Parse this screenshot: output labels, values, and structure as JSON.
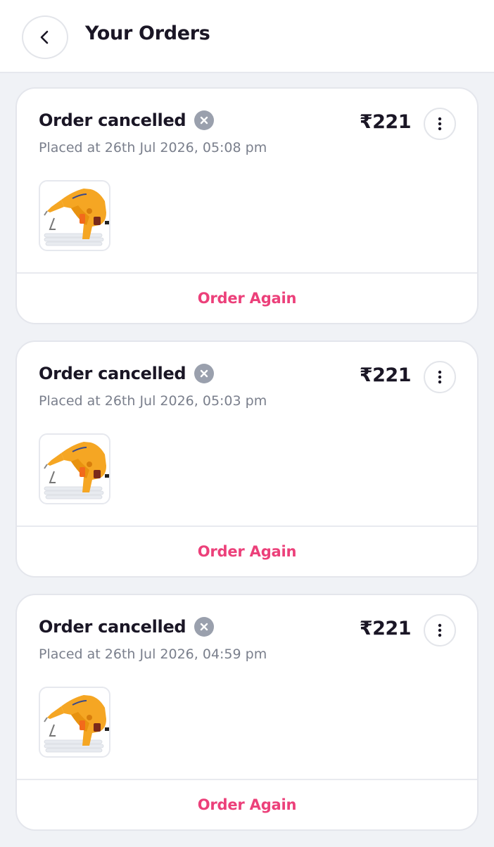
{
  "header": {
    "title": "Your Orders",
    "back_icon": "chevron-left-icon"
  },
  "colors": {
    "background": "#f0f2f6",
    "card": "#ffffff",
    "text_primary": "#1a1625",
    "text_secondary": "#7a7f8c",
    "accent": "#ec407a",
    "cancel_badge": "#9aa0ad"
  },
  "orders": [
    {
      "status": "Order cancelled",
      "status_icon": "x-circle-icon",
      "placed": "Placed at 26th Jul 2026, 05:08 pm",
      "price": "₹221",
      "more_icon": "more-vertical-icon",
      "item_image": "glue-gun-image",
      "action_label": "Order Again"
    },
    {
      "status": "Order cancelled",
      "status_icon": "x-circle-icon",
      "placed": "Placed at 26th Jul 2026, 05:03 pm",
      "price": "₹221",
      "more_icon": "more-vertical-icon",
      "item_image": "glue-gun-image",
      "action_label": "Order Again"
    },
    {
      "status": "Order cancelled",
      "status_icon": "x-circle-icon",
      "placed": "Placed at 26th Jul 2026, 04:59 pm",
      "price": "₹221",
      "more_icon": "more-vertical-icon",
      "item_image": "glue-gun-image",
      "action_label": "Order Again"
    }
  ]
}
